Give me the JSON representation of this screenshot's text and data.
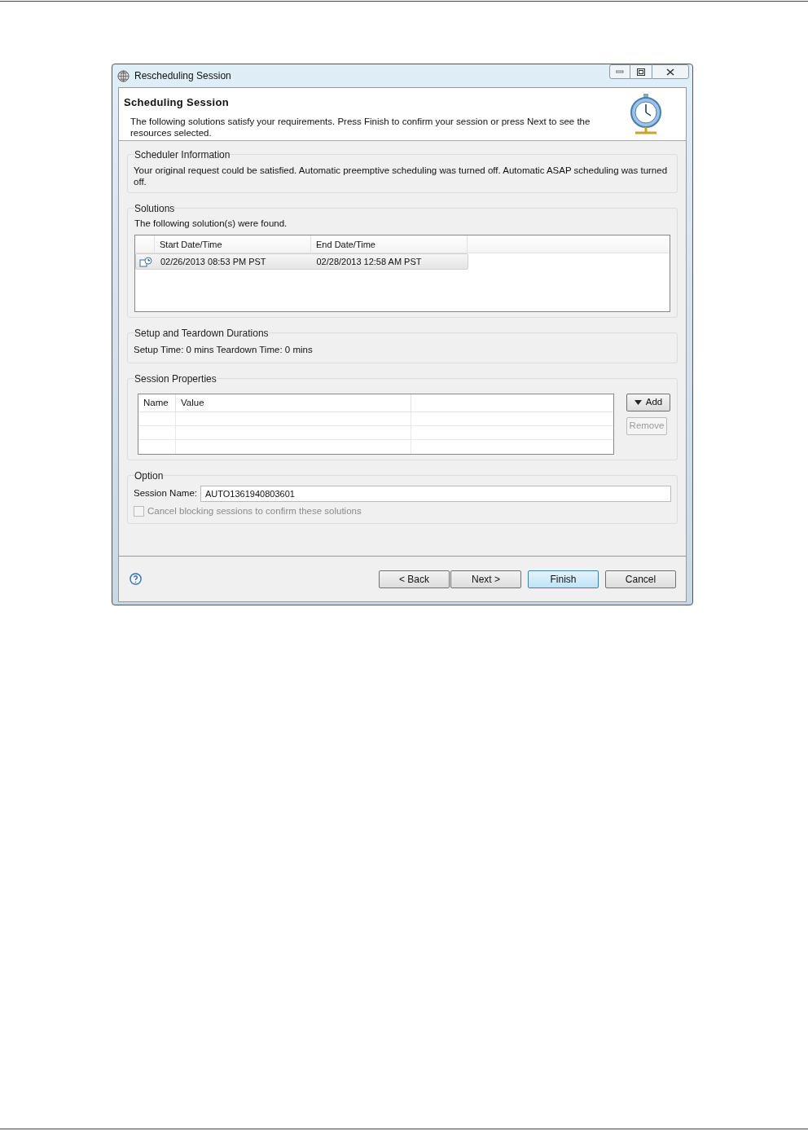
{
  "window": {
    "title": "Rescheduling Session"
  },
  "header": {
    "title": "Scheduling Session",
    "description": "The following solutions satisfy your requirements.  Press Finish to confirm your session or press Next to see the resources selected."
  },
  "scheduler_info": {
    "title": "Scheduler Information",
    "text": "Your original request could be satisfied. Automatic preemptive scheduling was turned off. Automatic ASAP scheduling was turned off."
  },
  "solutions": {
    "title": "Solutions",
    "text": "The following solution(s) were found.",
    "columns": [
      "Start Date/Time",
      "End Date/Time"
    ],
    "rows": [
      {
        "start": "02/26/2013 08:53 PM PST",
        "end": "02/28/2013 12:58 AM PST",
        "selected": true
      }
    ]
  },
  "durations": {
    "title": "Setup and Teardown Durations",
    "text": "Setup Time: 0 mins Teardown Time: 0 mins"
  },
  "session_properties": {
    "title": "Session Properties",
    "columns": [
      "Name",
      "Value"
    ],
    "buttons": [
      {
        "label": "Add",
        "kind": "dropdown",
        "disabled": false
      },
      {
        "label": "Remove",
        "kind": "plain",
        "disabled": true
      }
    ]
  },
  "option": {
    "title": "Option",
    "session_name_label": "Session Name:",
    "session_name_value": "AUTO1361940803601",
    "checkbox": {
      "label": "Cancel blocking sessions to confirm these solutions",
      "checked": false,
      "disabled": true
    }
  },
  "buttons": [
    {
      "label": "< Back",
      "default": false
    },
    {
      "label": "Next >",
      "default": false
    },
    {
      "label": "Finish",
      "default": true
    },
    {
      "label": "Cancel",
      "default": false
    }
  ]
}
